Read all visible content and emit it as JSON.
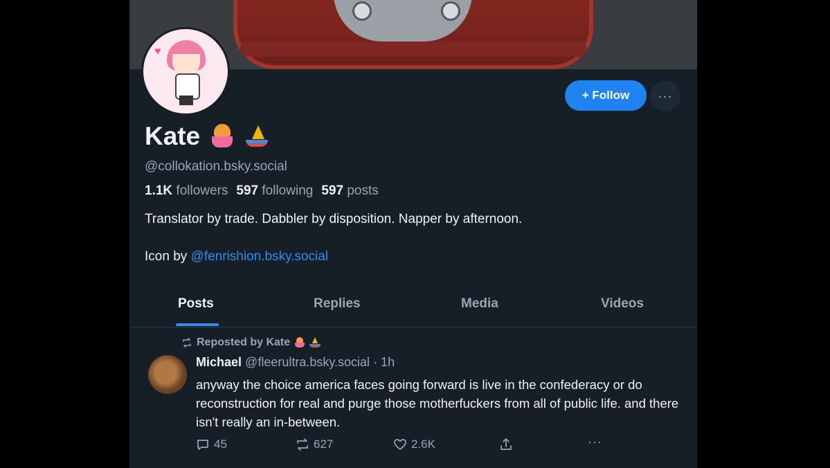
{
  "profile": {
    "display_name": "Kate",
    "handle": "@collokation.bsky.social",
    "stats": {
      "followers_count": "1.1K",
      "followers_label": "followers",
      "following_count": "597",
      "following_label": "following",
      "posts_count": "597",
      "posts_label": "posts"
    },
    "bio_line1": "Translator by trade. Dabbler by disposition. Napper by afternoon.",
    "bio_line2_prefix": "Icon by ",
    "bio_link": "@fenrishion.bsky.social",
    "follow_label": "+ Follow",
    "more_label": "···"
  },
  "tabs": [
    {
      "label": "Posts",
      "active": true
    },
    {
      "label": "Replies",
      "active": false
    },
    {
      "label": "Media",
      "active": false
    },
    {
      "label": "Videos",
      "active": false
    }
  ],
  "post": {
    "repost_label": "Reposted by Kate",
    "author": "Michael",
    "author_handle": "@fleerultra.bsky.social",
    "time": "· 1h",
    "text": "anyway the choice america faces going forward is live in the confederacy or do reconstruction for real and purge those motherfuckers from all of public life. and there isn't really an in-between.",
    "replies": "45",
    "reposts": "627",
    "likes": "2.6K",
    "more_label": "···"
  },
  "colors": {
    "background": "#161e27",
    "accent": "#1f84ef",
    "muted_text": "#9aa6b4"
  },
  "icons": [
    "reply-icon",
    "repost-icon",
    "like-icon",
    "share-icon",
    "more-icon"
  ]
}
